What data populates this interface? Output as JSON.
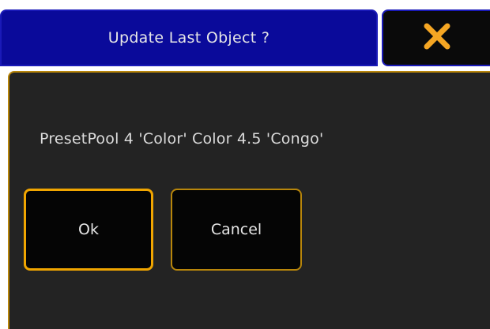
{
  "dialog": {
    "title": "Update Last Object ?",
    "message": "PresetPool 4 'Color' Color 4.5 'Congo'",
    "ok_label": "Ok",
    "cancel_label": "Cancel",
    "close_icon": "close-x-icon"
  },
  "colors": {
    "title_bar": "#0a0a9a",
    "body_bg": "#232323",
    "accent": "#f0a500"
  }
}
